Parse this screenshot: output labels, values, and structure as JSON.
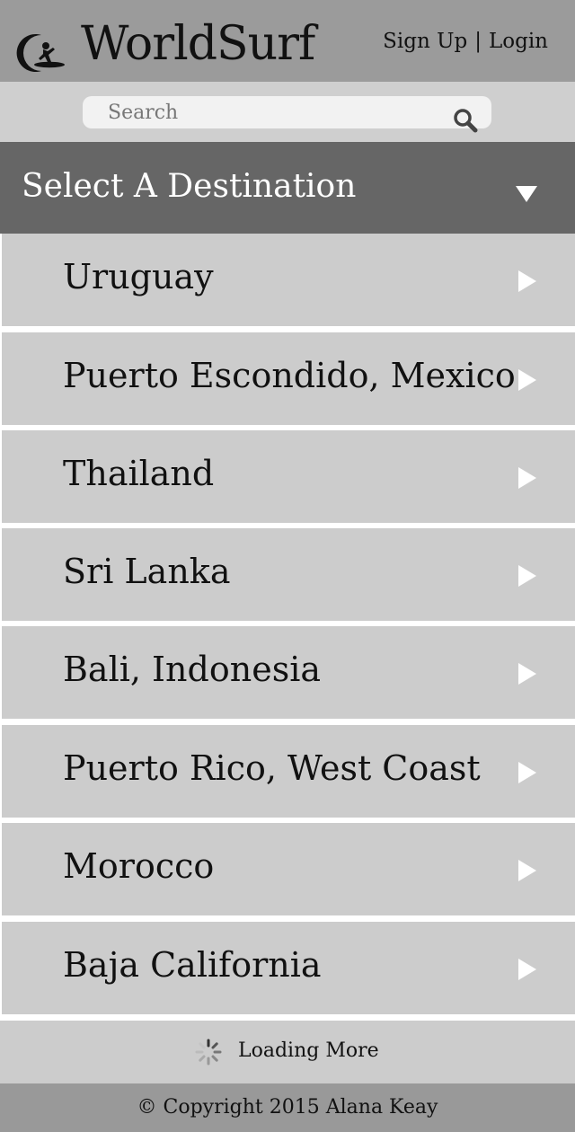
{
  "header": {
    "brand": "WorldSurf",
    "logo_icon": "surfer-logo-icon",
    "sign_up": "Sign Up",
    "separator": "|",
    "login": "Login"
  },
  "search": {
    "placeholder": "Search",
    "icon": "search-icon"
  },
  "destination_header": {
    "title": "Select A Destination",
    "icon": "caret-down-icon"
  },
  "destinations": [
    {
      "label": "Uruguay"
    },
    {
      "label": "Puerto Escondido, Mexico"
    },
    {
      "label": "Thailand"
    },
    {
      "label": "Sri Lanka"
    },
    {
      "label": "Bali, Indonesia"
    },
    {
      "label": "Puerto Rico, West Coast"
    },
    {
      "label": "Morocco"
    },
    {
      "label": "Baja California"
    }
  ],
  "loading": {
    "label": "Loading More",
    "icon": "spinner-icon"
  },
  "footer": {
    "copyright": "© Copyright 2015 Alana Keay"
  },
  "colors": {
    "header_bg": "#9b9b9b",
    "search_bar_bg": "#cfcfcf",
    "dest_header_bg": "#666666",
    "list_item_bg": "#cccccc",
    "footer_bg": "#999999",
    "arrow": "#ffffff"
  }
}
